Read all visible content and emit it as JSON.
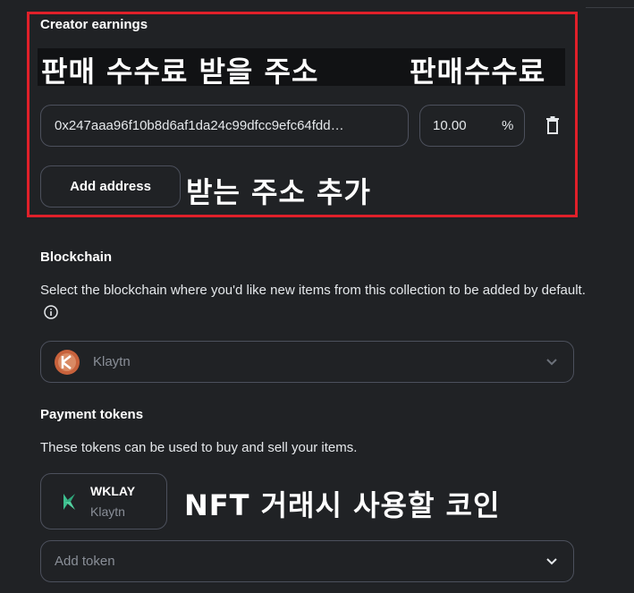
{
  "creator_earnings": {
    "title": "Creator earnings",
    "address_value": "0x247aaa96f10b8d6af1da24c99dfcc9efc64fdd…",
    "percent_value": "10.00",
    "percent_symbol": "%",
    "add_address_label": "Add address"
  },
  "annotations": {
    "address_note": "판매 수수료 받을 주소",
    "fee_note": "판매수수료",
    "add_note": "받는 주소 추가",
    "token_note": "NFT 거래시 사용할 코인"
  },
  "blockchain": {
    "title": "Blockchain",
    "description": "Select the blockchain where you'd like new items from this collection to be added by default.",
    "selected": "Klaytn",
    "icon": "klaytn-logo-icon"
  },
  "payment_tokens": {
    "title": "Payment tokens",
    "description": "These tokens can be used to buy and sell your items.",
    "tokens": [
      {
        "symbol": "WKLAY",
        "network": "Klaytn",
        "icon": "klaytn-logo-icon"
      }
    ],
    "add_token_placeholder": "Add token"
  },
  "colors": {
    "background": "#202225",
    "border": "#4c505c",
    "highlight": "#e0202a",
    "klaytn_green": "#3dbf8f",
    "klaytn_orange": "#c8623c"
  }
}
